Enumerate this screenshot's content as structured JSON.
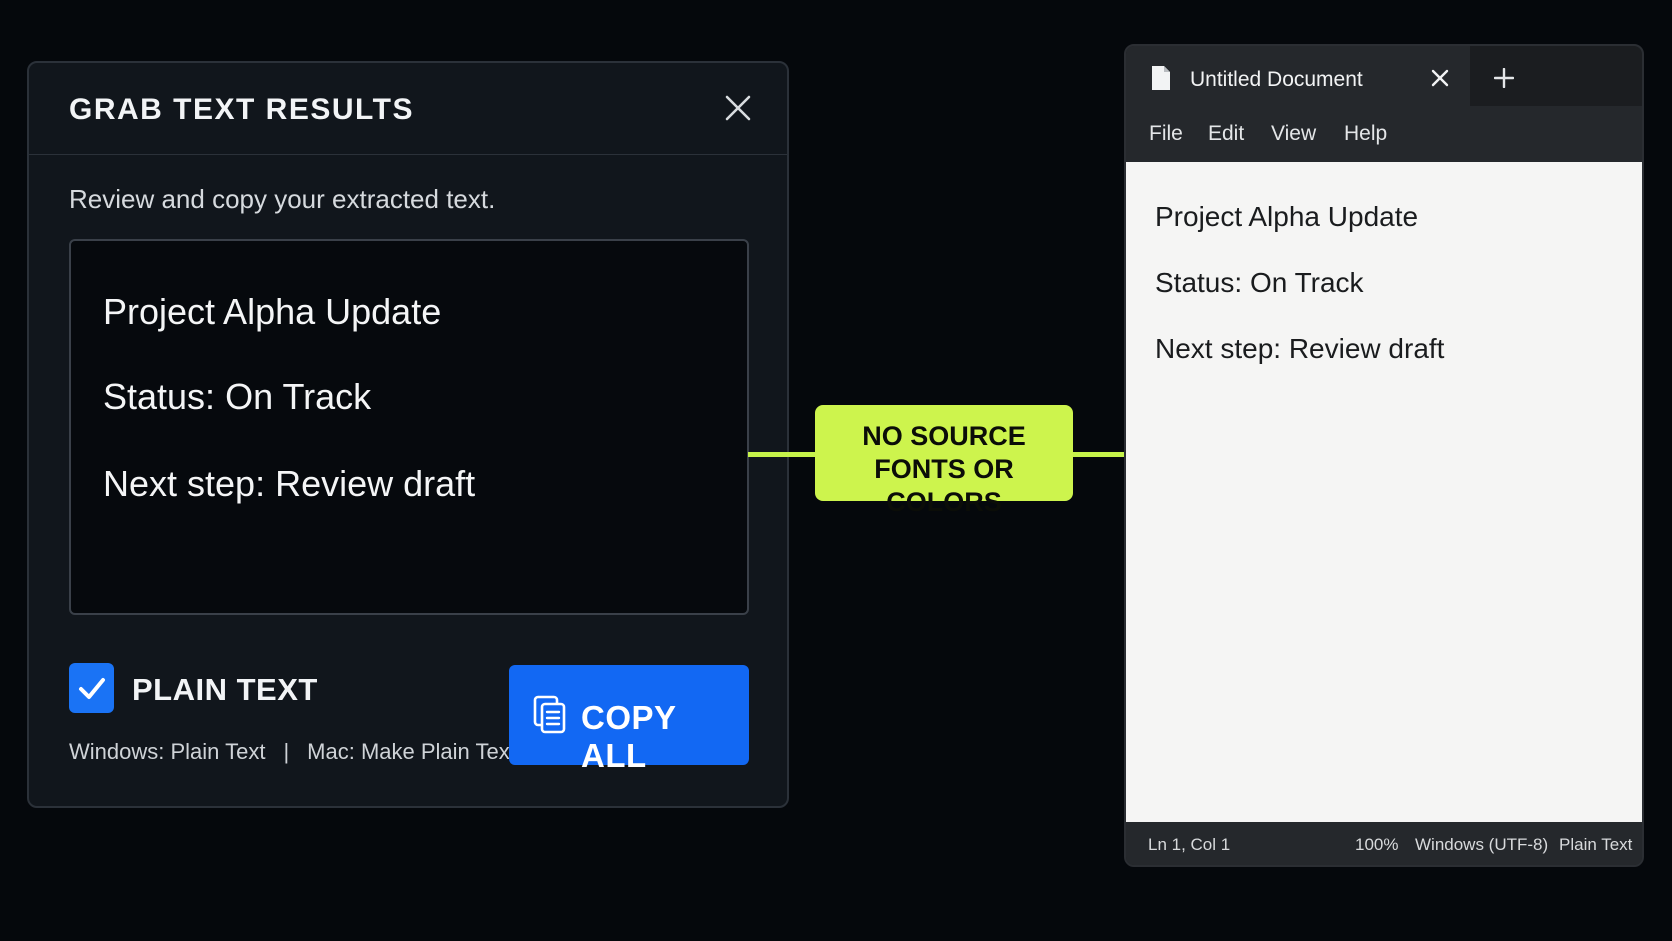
{
  "dialog": {
    "title": "GRAB TEXT RESULTS",
    "close_icon": "close-icon",
    "subtitle": "Review and copy your extracted text.",
    "result_lines": [
      "Project Alpha Update",
      "Status: On Track",
      "Next step: Review draft"
    ],
    "checkbox": {
      "checked": true,
      "label": "PLAIN TEXT",
      "color": "#1a73f5"
    },
    "shortcut_windows": "Windows: Plain Text",
    "shortcut_sep": "|",
    "shortcut_mac": "Mac: Make Plain Text",
    "copy_button": {
      "label": "COPY ALL",
      "icon": "copy-icon",
      "color": "#1268f3"
    }
  },
  "callout": {
    "line1": "NO SOURCE",
    "line2": "FONTS OR COLORS",
    "color": "#cdf44d"
  },
  "editor": {
    "tab_title": "Untitled Document",
    "doc_icon": "document-icon",
    "new_tab_icon": "plus-icon",
    "menu": [
      "File",
      "Edit",
      "View",
      "Help"
    ],
    "lines": [
      "Project Alpha Update",
      "Status: On Track",
      "Next step: Review draft"
    ],
    "status": {
      "position": "Ln 1, Col 1",
      "zoom": "100%",
      "encoding": "Windows (UTF-8)",
      "format": "Plain Text"
    }
  }
}
